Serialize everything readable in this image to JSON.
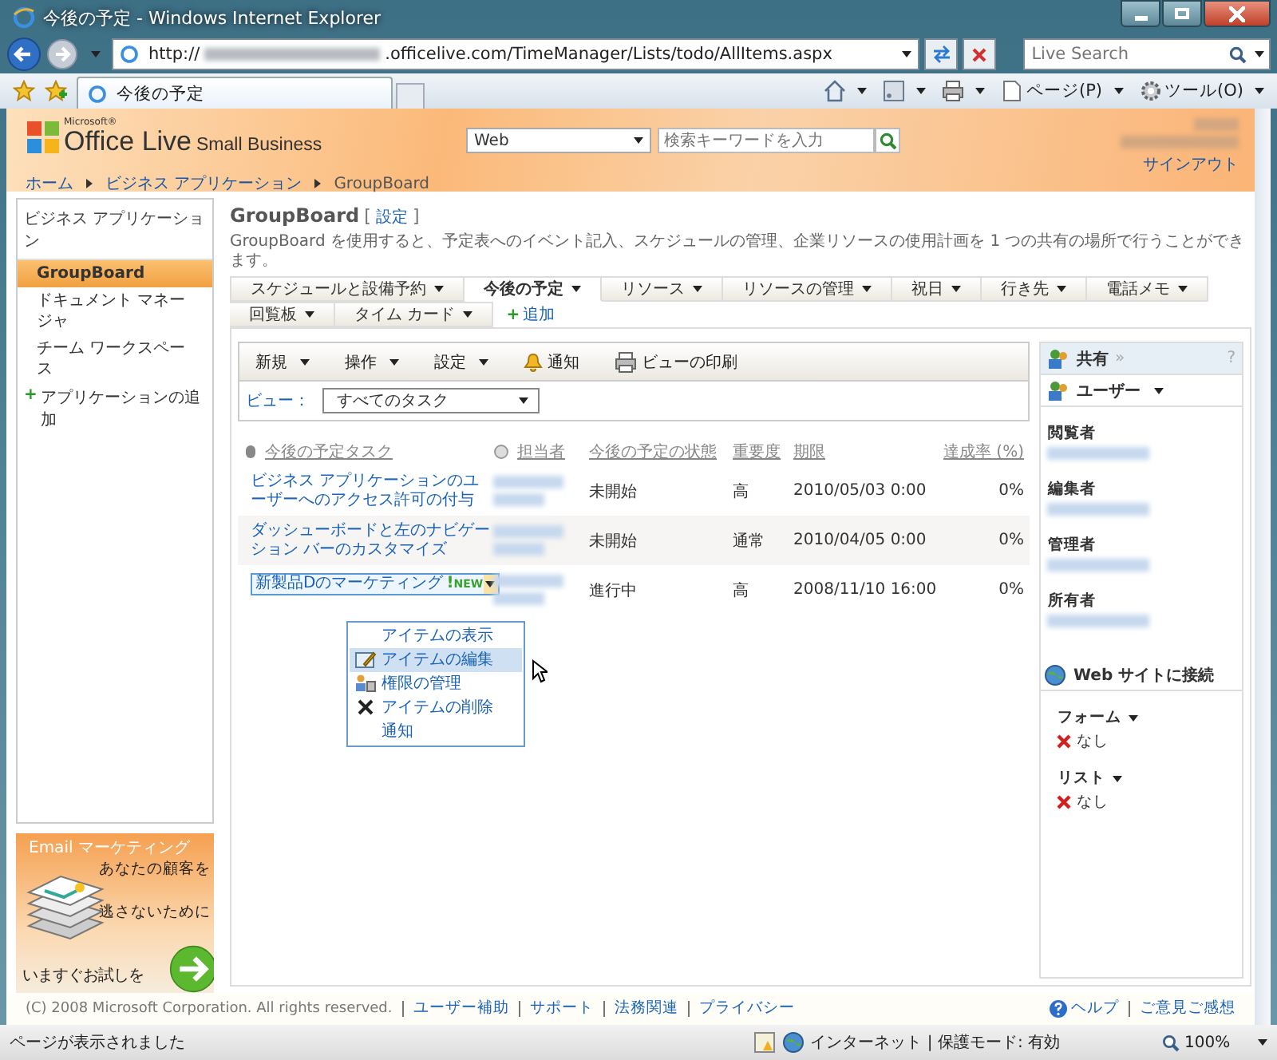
{
  "window": {
    "title": "今後の予定 - Windows Internet Explorer"
  },
  "address_bar": {
    "url_start": "http://",
    "url_end": ".officelive.com/TimeManager/Lists/todo/AllItems.aspx"
  },
  "search_box": {
    "placeholder": "Live Search"
  },
  "browser_tabs": [
    {
      "label": "今後の予定",
      "selected": true
    }
  ],
  "command_bar": [
    {
      "kind": "home"
    },
    {
      "kind": "feeds"
    },
    {
      "kind": "print"
    },
    {
      "kind": "page",
      "label": "ページ(P)"
    },
    {
      "kind": "tools",
      "label": "ツール(O)"
    }
  ],
  "site_header": {
    "logo_small": "Microsoft®",
    "logo": "Office Live",
    "logo_suffix": "Small Business",
    "search_scope": "Web",
    "search_placeholder": "検索キーワードを入力",
    "sign_out": "サインアウト"
  },
  "breadcrumb": [
    "ホーム",
    "ビジネス アプリケーション",
    "GroupBoard"
  ],
  "sidebar": {
    "heading": "ビジネス アプリケーション",
    "items": [
      {
        "label": "GroupBoard",
        "selected": true
      },
      {
        "label": "ドキュメント マネージャ",
        "selected": false
      },
      {
        "label": "チーム ワークスペース",
        "selected": false
      }
    ],
    "add_sign": "+",
    "add_link": "アプリケーションの追加"
  },
  "ad": {
    "title": "Email マーケティング",
    "lines": [
      "あなたの顧客を",
      "逃さないために"
    ],
    "cta": "いますぐお試しを"
  },
  "page": {
    "title": "GroupBoard",
    "bracket_open": "[",
    "settings_link": "設定",
    "bracket_close": "]",
    "description": "GroupBoard を使用すると、予定表へのイベント記入、スケジュールの管理、企業リソースの使用計画を 1 つの共有の場所で行うことができます。"
  },
  "app_tabs": [
    {
      "label": "スケジュールと設備予約",
      "selected": false
    },
    {
      "label": "今後の予定",
      "selected": true
    },
    {
      "label": "リソース",
      "selected": false
    },
    {
      "label": "リソースの管理",
      "selected": false
    },
    {
      "label": "祝日",
      "selected": false
    },
    {
      "label": "行き先",
      "selected": false
    },
    {
      "label": "電話メモ",
      "selected": false
    },
    {
      "label": "回覧板",
      "selected": false
    },
    {
      "label": "タイム カード",
      "selected": false
    }
  ],
  "add_tab": {
    "sign": "+",
    "label": "追加"
  },
  "toolbar": [
    {
      "label": "新規",
      "kind": "menu"
    },
    {
      "label": "操作",
      "kind": "menu"
    },
    {
      "label": "設定",
      "kind": "menu"
    },
    {
      "label": "通知",
      "kind": "alert"
    },
    {
      "label": "ビューの印刷",
      "kind": "print"
    }
  ],
  "view": {
    "label": "ビュー：",
    "value": "すべてのタスク"
  },
  "table": {
    "columns": [
      "今後の予定タスク",
      "担当者",
      "今後の予定の状態",
      "重要度",
      "期限",
      "達成率 (%)"
    ],
    "rows": [
      {
        "title": "ビジネス アプリケーションのユーザーへのアクセス許可の付与",
        "status": "未開始",
        "priority": "高",
        "due": "2010/05/03 0:00",
        "percent": "0%",
        "menu_open": false
      },
      {
        "title": "ダッシューボードと左のナビゲーション バーのカスタマイズ",
        "status": "未開始",
        "priority": "通常",
        "due": "2010/04/05 0:00",
        "percent": "0%",
        "menu_open": false
      },
      {
        "title": "新製品Dのマーケティング",
        "mark": "!",
        "badge": "NEW",
        "status": "進行中",
        "priority": "高",
        "due": "2008/11/10 16:00",
        "percent": "0%",
        "menu_open": true
      }
    ]
  },
  "item_menu": [
    {
      "label": "アイテムの表示",
      "kind": "view",
      "selected": false
    },
    {
      "label": "アイテムの編集",
      "kind": "edit",
      "selected": true
    },
    {
      "label": "権限の管理",
      "kind": "permissions",
      "selected": false
    },
    {
      "label": "アイテムの削除",
      "kind": "delete",
      "selected": false
    },
    {
      "label": "通知",
      "kind": "alert",
      "selected": false
    }
  ],
  "share_panel": {
    "title": "共有",
    "more": "»",
    "help": "?",
    "users_menu": "ユーザー",
    "roles": [
      "閲覧者",
      "編集者",
      "管理者",
      "所有者"
    ],
    "connect_title": "Web サイトに接続",
    "connections": [
      {
        "label": "フォーム",
        "value": "なし"
      },
      {
        "label": "リスト",
        "value": "なし"
      }
    ]
  },
  "footer": {
    "copyright": "(C) 2008 Microsoft Corporation. All rights reserved.",
    "links": [
      "ユーザー補助",
      "サポート",
      "法務関連",
      "プライバシー"
    ],
    "right_links": [
      {
        "label": "ヘルプ",
        "kind": "help"
      },
      {
        "label": "ご意見ご感想",
        "kind": "plain"
      }
    ]
  },
  "status_bar": {
    "message": "ページが表示されました",
    "zone": "インターネット | 保護モード: 有効",
    "zoom": "100%"
  }
}
